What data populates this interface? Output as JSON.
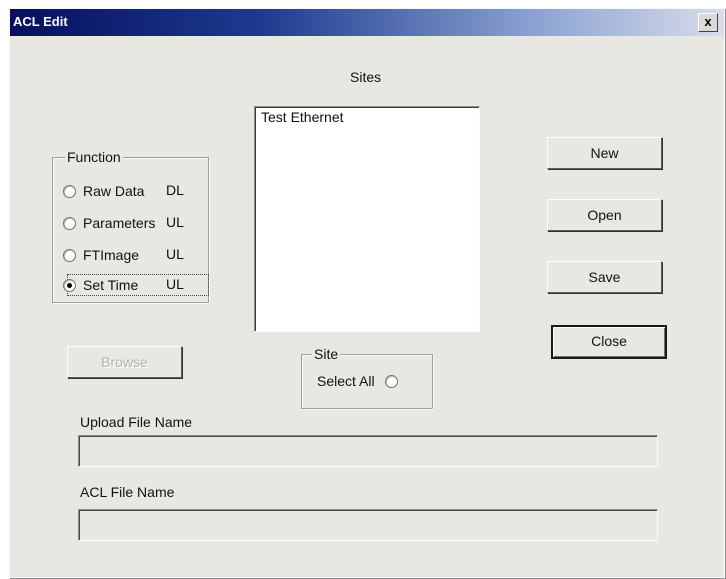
{
  "window": {
    "title": "ACL Edit",
    "close_glyph": "x"
  },
  "sites": {
    "label": "Sites",
    "items": [
      "Test Ethernet"
    ]
  },
  "function": {
    "legend": "Function",
    "options": [
      {
        "label": "Raw Data",
        "suffix": "DL",
        "checked": false
      },
      {
        "label": "Parameters",
        "suffix": "UL",
        "checked": false
      },
      {
        "label": "FTImage",
        "suffix": "UL",
        "checked": false
      },
      {
        "label": "Set Time",
        "suffix": "UL",
        "checked": true
      }
    ]
  },
  "buttons": {
    "new": "New",
    "open": "Open",
    "save": "Save",
    "close": "Close",
    "browse": "Browse"
  },
  "site_group": {
    "legend": "Site",
    "select_all": "Select All",
    "select_all_checked": false
  },
  "upload": {
    "label": "Upload File Name",
    "value": ""
  },
  "acl": {
    "label": "ACL File Name",
    "value": ""
  }
}
